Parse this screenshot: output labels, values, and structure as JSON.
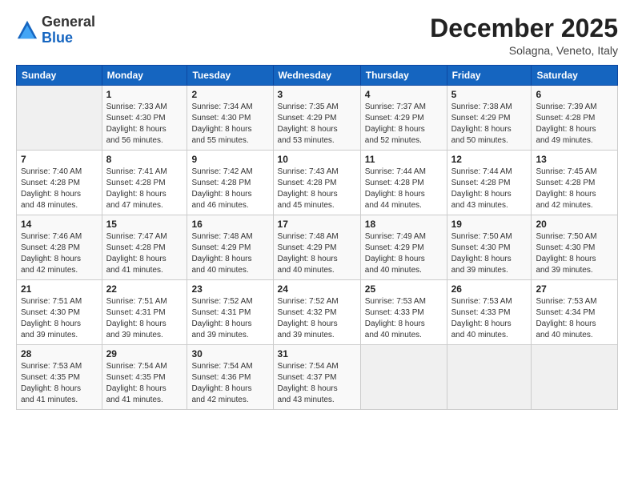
{
  "header": {
    "logo_general": "General",
    "logo_blue": "Blue",
    "month_title": "December 2025",
    "location": "Solagna, Veneto, Italy"
  },
  "weekdays": [
    "Sunday",
    "Monday",
    "Tuesday",
    "Wednesday",
    "Thursday",
    "Friday",
    "Saturday"
  ],
  "weeks": [
    [
      {
        "day": "",
        "info": ""
      },
      {
        "day": "1",
        "info": "Sunrise: 7:33 AM\nSunset: 4:30 PM\nDaylight: 8 hours\nand 56 minutes."
      },
      {
        "day": "2",
        "info": "Sunrise: 7:34 AM\nSunset: 4:30 PM\nDaylight: 8 hours\nand 55 minutes."
      },
      {
        "day": "3",
        "info": "Sunrise: 7:35 AM\nSunset: 4:29 PM\nDaylight: 8 hours\nand 53 minutes."
      },
      {
        "day": "4",
        "info": "Sunrise: 7:37 AM\nSunset: 4:29 PM\nDaylight: 8 hours\nand 52 minutes."
      },
      {
        "day": "5",
        "info": "Sunrise: 7:38 AM\nSunset: 4:29 PM\nDaylight: 8 hours\nand 50 minutes."
      },
      {
        "day": "6",
        "info": "Sunrise: 7:39 AM\nSunset: 4:28 PM\nDaylight: 8 hours\nand 49 minutes."
      }
    ],
    [
      {
        "day": "7",
        "info": "Sunrise: 7:40 AM\nSunset: 4:28 PM\nDaylight: 8 hours\nand 48 minutes."
      },
      {
        "day": "8",
        "info": "Sunrise: 7:41 AM\nSunset: 4:28 PM\nDaylight: 8 hours\nand 47 minutes."
      },
      {
        "day": "9",
        "info": "Sunrise: 7:42 AM\nSunset: 4:28 PM\nDaylight: 8 hours\nand 46 minutes."
      },
      {
        "day": "10",
        "info": "Sunrise: 7:43 AM\nSunset: 4:28 PM\nDaylight: 8 hours\nand 45 minutes."
      },
      {
        "day": "11",
        "info": "Sunrise: 7:44 AM\nSunset: 4:28 PM\nDaylight: 8 hours\nand 44 minutes."
      },
      {
        "day": "12",
        "info": "Sunrise: 7:44 AM\nSunset: 4:28 PM\nDaylight: 8 hours\nand 43 minutes."
      },
      {
        "day": "13",
        "info": "Sunrise: 7:45 AM\nSunset: 4:28 PM\nDaylight: 8 hours\nand 42 minutes."
      }
    ],
    [
      {
        "day": "14",
        "info": "Sunrise: 7:46 AM\nSunset: 4:28 PM\nDaylight: 8 hours\nand 42 minutes."
      },
      {
        "day": "15",
        "info": "Sunrise: 7:47 AM\nSunset: 4:28 PM\nDaylight: 8 hours\nand 41 minutes."
      },
      {
        "day": "16",
        "info": "Sunrise: 7:48 AM\nSunset: 4:29 PM\nDaylight: 8 hours\nand 40 minutes."
      },
      {
        "day": "17",
        "info": "Sunrise: 7:48 AM\nSunset: 4:29 PM\nDaylight: 8 hours\nand 40 minutes."
      },
      {
        "day": "18",
        "info": "Sunrise: 7:49 AM\nSunset: 4:29 PM\nDaylight: 8 hours\nand 40 minutes."
      },
      {
        "day": "19",
        "info": "Sunrise: 7:50 AM\nSunset: 4:30 PM\nDaylight: 8 hours\nand 39 minutes."
      },
      {
        "day": "20",
        "info": "Sunrise: 7:50 AM\nSunset: 4:30 PM\nDaylight: 8 hours\nand 39 minutes."
      }
    ],
    [
      {
        "day": "21",
        "info": "Sunrise: 7:51 AM\nSunset: 4:30 PM\nDaylight: 8 hours\nand 39 minutes."
      },
      {
        "day": "22",
        "info": "Sunrise: 7:51 AM\nSunset: 4:31 PM\nDaylight: 8 hours\nand 39 minutes."
      },
      {
        "day": "23",
        "info": "Sunrise: 7:52 AM\nSunset: 4:31 PM\nDaylight: 8 hours\nand 39 minutes."
      },
      {
        "day": "24",
        "info": "Sunrise: 7:52 AM\nSunset: 4:32 PM\nDaylight: 8 hours\nand 39 minutes."
      },
      {
        "day": "25",
        "info": "Sunrise: 7:53 AM\nSunset: 4:33 PM\nDaylight: 8 hours\nand 40 minutes."
      },
      {
        "day": "26",
        "info": "Sunrise: 7:53 AM\nSunset: 4:33 PM\nDaylight: 8 hours\nand 40 minutes."
      },
      {
        "day": "27",
        "info": "Sunrise: 7:53 AM\nSunset: 4:34 PM\nDaylight: 8 hours\nand 40 minutes."
      }
    ],
    [
      {
        "day": "28",
        "info": "Sunrise: 7:53 AM\nSunset: 4:35 PM\nDaylight: 8 hours\nand 41 minutes."
      },
      {
        "day": "29",
        "info": "Sunrise: 7:54 AM\nSunset: 4:35 PM\nDaylight: 8 hours\nand 41 minutes."
      },
      {
        "day": "30",
        "info": "Sunrise: 7:54 AM\nSunset: 4:36 PM\nDaylight: 8 hours\nand 42 minutes."
      },
      {
        "day": "31",
        "info": "Sunrise: 7:54 AM\nSunset: 4:37 PM\nDaylight: 8 hours\nand 43 minutes."
      },
      {
        "day": "",
        "info": ""
      },
      {
        "day": "",
        "info": ""
      },
      {
        "day": "",
        "info": ""
      }
    ]
  ]
}
